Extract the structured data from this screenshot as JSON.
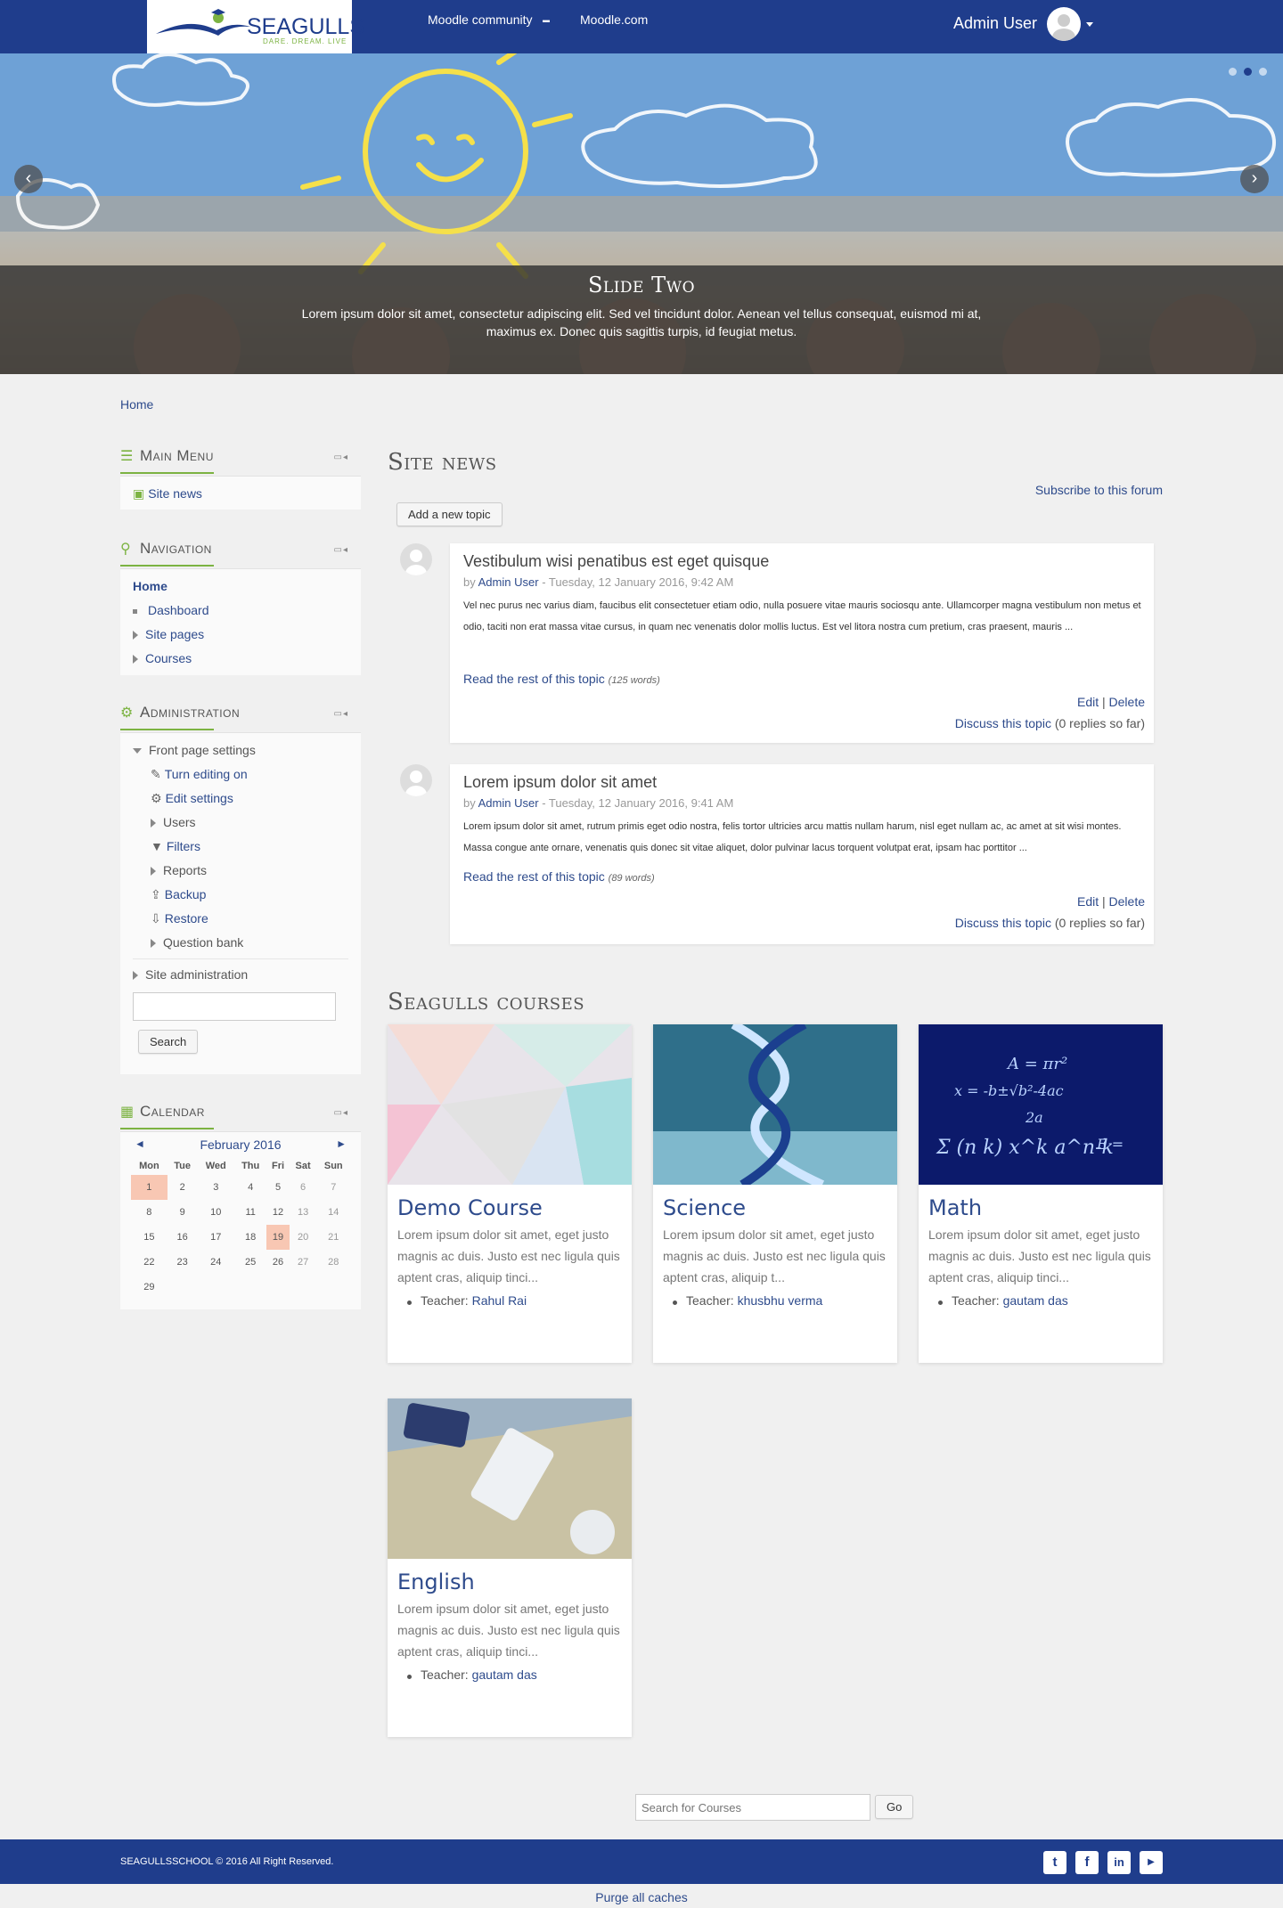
{
  "header": {
    "logo_text": "SEAGULLS",
    "logo_tagline": "DARE. DREAM. LIVE",
    "nav": [
      "Moodle community",
      "Moodle.com"
    ],
    "user_name": "Admin User",
    "bg_color": "#1f3d8c"
  },
  "slider": {
    "title": "Slide Two",
    "text": "Lorem ipsum dolor sit amet, consectetur adipiscing elit. Sed vel tincidunt dolor. Aenean vel tellus consequat, euismod mi at, maximus ex. Donec quis sagittis turpis, id feugiat metus.",
    "prev_label": "‹",
    "next_label": "›",
    "slide_count": 3,
    "active_slide": 2
  },
  "breadcrumb": "Home",
  "main_menu": {
    "title": "Main Menu",
    "items": [
      "Site news"
    ]
  },
  "navigation": {
    "title": "Navigation",
    "home": "Home",
    "items": [
      "Dashboard",
      "Site pages",
      "Courses"
    ]
  },
  "administration": {
    "title": "Administration",
    "front_page": "Front page settings",
    "items": [
      "Turn editing on",
      "Edit settings",
      "Users",
      "Filters",
      "Reports",
      "Backup",
      "Restore",
      "Question bank"
    ],
    "site_admin": "Site administration",
    "search_button": "Search"
  },
  "calendar": {
    "title": "Calendar",
    "month": "February 2016",
    "prev": "◄",
    "next": "►",
    "days": [
      "Mon",
      "Tue",
      "Wed",
      "Thu",
      "Fri",
      "Sat",
      "Sun"
    ],
    "weeks": [
      [
        "1",
        "2",
        "3",
        "4",
        "5",
        "6",
        "7"
      ],
      [
        "8",
        "9",
        "10",
        "11",
        "12",
        "13",
        "14"
      ],
      [
        "15",
        "16",
        "17",
        "18",
        "19",
        "20",
        "21"
      ],
      [
        "22",
        "23",
        "24",
        "25",
        "26",
        "27",
        "28"
      ],
      [
        "29",
        "",
        "",
        "",
        "",
        "",
        ""
      ]
    ]
  },
  "site_news": {
    "title": "Site news",
    "subscribe": "Subscribe to this forum",
    "add_topic": "Add a new topic",
    "posts": [
      {
        "title": "Vestibulum wisi penatibus est eget quisque",
        "by": "by",
        "author": "Admin User",
        "date": "- Tuesday, 12 January 2016, 9:42 AM",
        "text": " Vel nec purus nec varius diam, faucibus elit consectetuer etiam odio, nulla posuere vitae mauris sociosqu ante. Ullamcorper magna vestibulum non metus et odio, taciti non erat massa vitae cursus, in quam nec venenatis dolor mollis luctus. Est vel litora nostra cum pretium, cras praesent, mauris ...",
        "read_more": "Read the rest of this topic",
        "words": "(125 words)",
        "edit": "Edit",
        "sep": "|",
        "delete": "Delete",
        "discuss": "Discuss this topic",
        "replies": "(0 replies so far)"
      },
      {
        "title": "Lorem ipsum dolor sit amet",
        "by": "by",
        "author": "Admin User",
        "date": "- Tuesday, 12 January 2016, 9:41 AM",
        "text": "Lorem ipsum dolor sit amet, rutrum primis eget odio nostra, felis tortor ultricies arcu mattis nullam harum, nisl eget nullam ac, ac amet at sit wisi montes. Massa congue ante ornare, venenatis quis donec sit vitae aliquet, dolor pulvinar lacus torquent volutpat erat, ipsam hac porttitor ...",
        "read_more": "Read the rest of this topic",
        "words": "(89 words)",
        "edit": "Edit",
        "sep": "|",
        "delete": "Delete",
        "discuss": "Discuss this topic",
        "replies": "(0 replies so far)"
      }
    ]
  },
  "courses": {
    "title": "Seagulls courses",
    "items": [
      {
        "name": "Demo Course",
        "desc": "Lorem ipsum dolor sit amet, eget justo magnis ac duis. Justo est nec ligula quis aptent cras, aliquip tinci...",
        "teacher_label": "Teacher:",
        "teacher": "Rahul Rai"
      },
      {
        "name": "Science",
        "desc": "Lorem ipsum dolor sit amet, eget justo magnis ac duis. Justo est nec ligula quis aptent cras, aliquip t...",
        "teacher_label": "Teacher:",
        "teacher": "khusbhu verma"
      },
      {
        "name": "Math",
        "desc": "Lorem ipsum dolor sit amet, eget justo magnis ac duis. Justo est nec ligula quis aptent cras, aliquip tinci...",
        "teacher_label": "Teacher:",
        "teacher": "gautam das"
      },
      {
        "name": "English",
        "desc": "Lorem ipsum dolor sit amet, eget justo magnis ac duis. Justo est nec ligula quis aptent cras, aliquip tinci...",
        "teacher_label": "Teacher:",
        "teacher": "gautam das"
      }
    ],
    "search_placeholder": "Search for Courses",
    "go": "Go"
  },
  "footer": {
    "copyright": "SEAGULLSSCHOOL © 2016 All Right Reserved.",
    "social": [
      "twitter-icon",
      "facebook-icon",
      "linkedin-icon",
      "youtube-icon"
    ],
    "purge": "Purge all caches"
  }
}
